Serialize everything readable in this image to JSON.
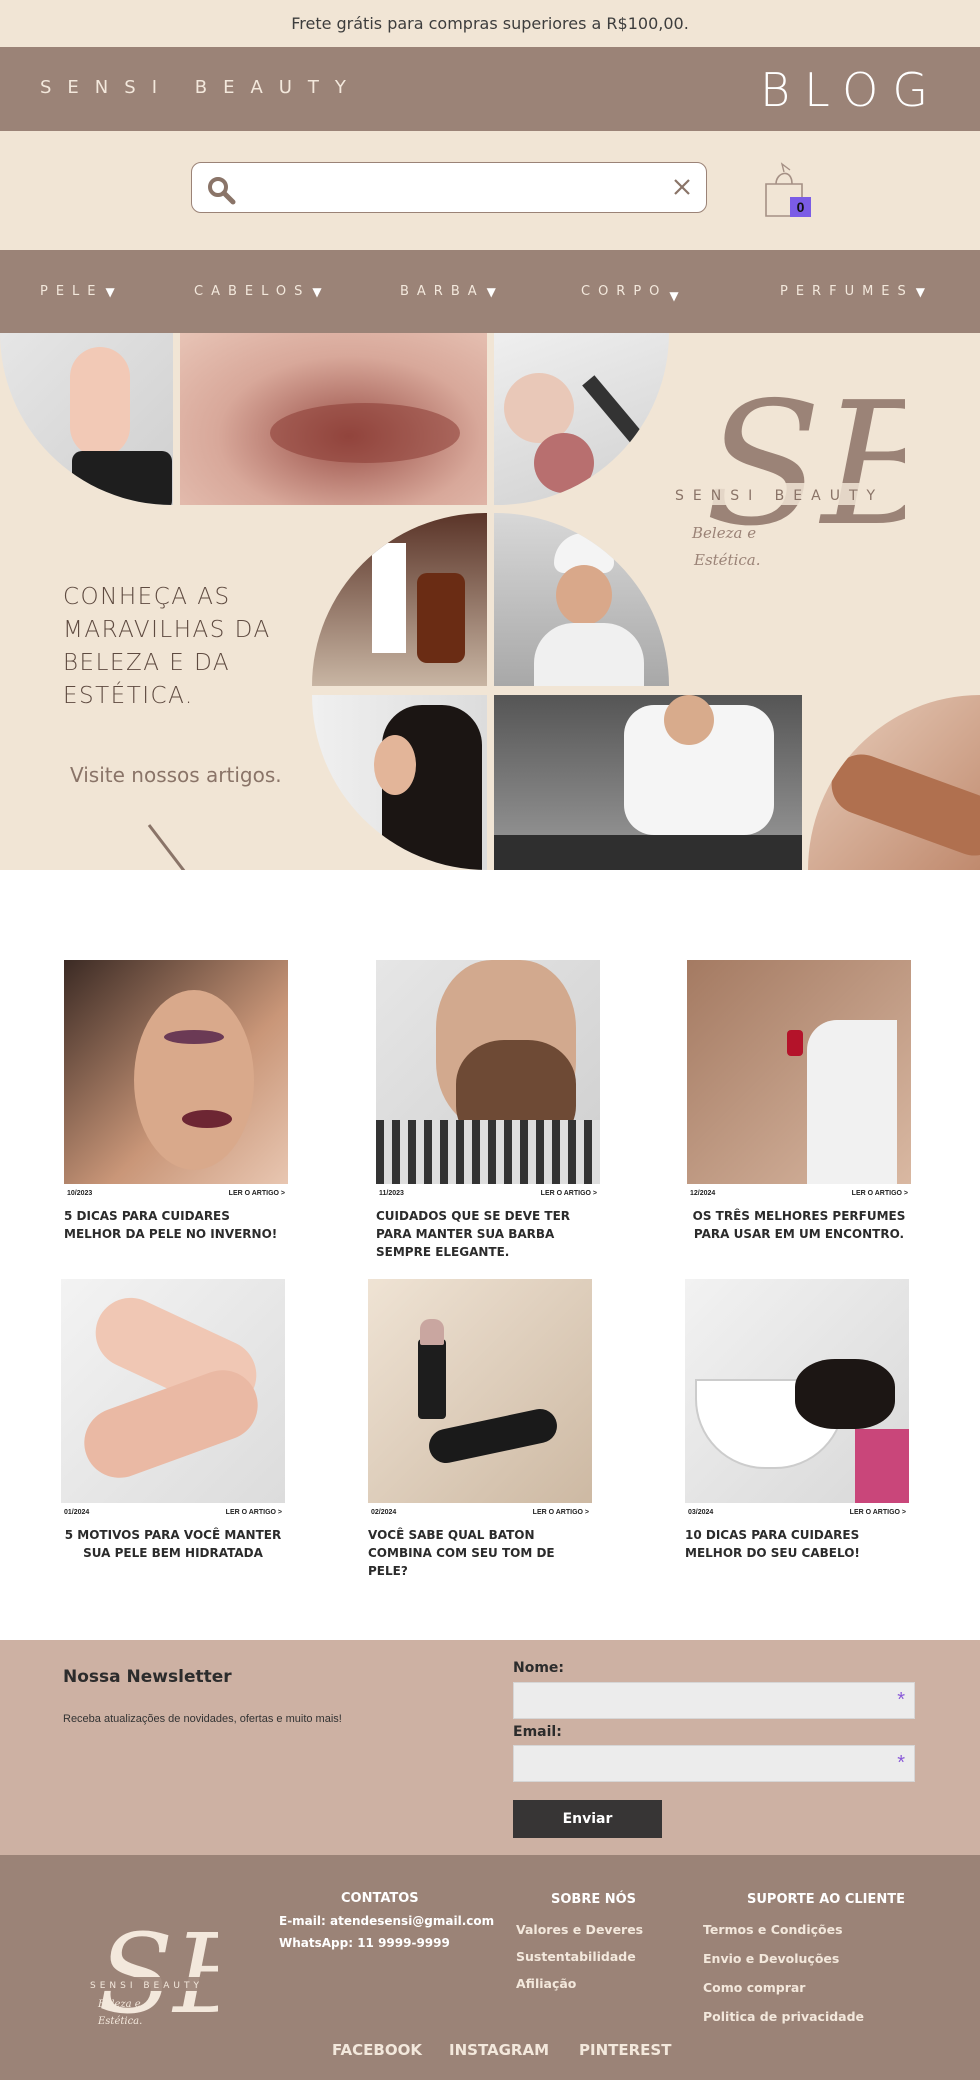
{
  "topbar": {
    "text": "Frete grátis para compras superiores a R$100,00."
  },
  "header": {
    "brand": "SENSI BEAUTY",
    "title": "BLOG"
  },
  "search": {
    "placeholder": "",
    "value": "",
    "icon": "search-icon",
    "clear_icon": "close-icon"
  },
  "cart": {
    "icon": "shopping-bag-icon",
    "count": "0"
  },
  "nav": {
    "items": [
      {
        "label": "PELE"
      },
      {
        "label": "CABELOS"
      },
      {
        "label": "BARBA"
      },
      {
        "label": "CORPO"
      },
      {
        "label": "PERFUMES"
      }
    ]
  },
  "hero": {
    "heading_lines": [
      "CONHEÇA AS",
      "MARAVILHAS DA",
      "BELEZA E DA",
      "ESTÉTICA."
    ],
    "cta": "Visite nossos artigos.",
    "logo": {
      "monogram": "SB",
      "brand": "SENSI BEAUTY",
      "tagline_1": "Beleza e",
      "tagline_2": "Estética."
    }
  },
  "articles": [
    {
      "date": "10/2023",
      "read": "LER O ARTIGO >",
      "title": "5 DICAS PARA CUIDARES MELHOR DA PELE NO INVERNO!"
    },
    {
      "date": "11/2023",
      "read": "LER O ARTIGO >",
      "title": "CUIDADOS QUE SE DEVE TER PARA MANTER SUA BARBA SEMPRE ELEGANTE."
    },
    {
      "date": "12/2024",
      "read": "LER O ARTIGO >",
      "title": "OS TRÊS MELHORES PERFUMES PARA USAR EM UM ENCONTRO."
    },
    {
      "date": "01/2024",
      "read": "LER O ARTIGO >",
      "title": "5 MOTIVOS PARA VOCÊ MANTER SUA PELE BEM HIDRATADA"
    },
    {
      "date": "02/2024",
      "read": "LER O ARTIGO >",
      "title": "VOCÊ SABE QUAL BATON COMBINA COM SEU TOM DE PELE?"
    },
    {
      "date": "03/2024",
      "read": "LER O ARTIGO >",
      "title": "10 DICAS PARA CUIDARES MELHOR DO SEU CABELO!"
    }
  ],
  "newsletter": {
    "title": "Nossa Newsletter",
    "subtitle": "Receba atualizações de novidades, ofertas e muito mais!",
    "name_label": "Nome:",
    "email_label": "Email:",
    "required_mark": "*",
    "button": "Enviar"
  },
  "footer": {
    "contacts": {
      "title": "CONTATOS",
      "email": "E-mail: atendesensi@gmail.com",
      "whatsapp": "WhatsApp: 11 9999-9999"
    },
    "about": {
      "title": "SOBRE NÓS",
      "links": [
        "Valores e Deveres",
        "Sustentabilidade",
        "Afiliação"
      ]
    },
    "support": {
      "title": "SUPORTE AO CLIENTE",
      "links": [
        "Termos e Condições",
        "Envio e Devoluções",
        "Como comprar",
        "Politica de privacidade"
      ]
    },
    "social": [
      "FACEBOOK",
      "INSTAGRAM",
      "PINTEREST"
    ]
  },
  "colors": {
    "cream": "#f1e5d5",
    "taupe": "#9b8377",
    "rose": "#cdb1a3",
    "accent": "#7b5ce6",
    "dark": "#373535"
  }
}
